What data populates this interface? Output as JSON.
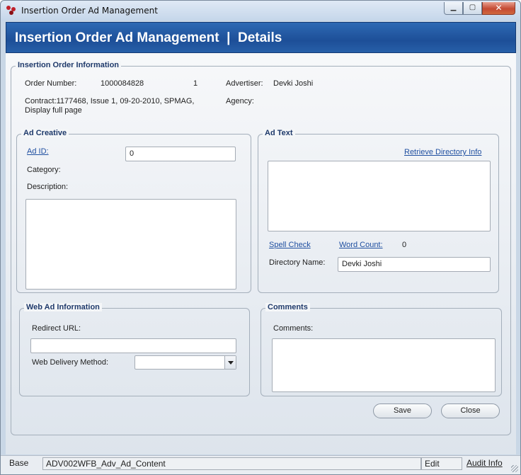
{
  "window": {
    "title": "Insertion Order Ad Management",
    "minimize_glyph": "▁",
    "maximize_glyph": "▢",
    "close_glyph": "✕"
  },
  "banner": {
    "title": "Insertion Order Ad Management  |  Details"
  },
  "io_info": {
    "legend": "Insertion Order Information",
    "order_number_label": "Order Number:",
    "order_number_value": "1000084828",
    "order_seq": "1",
    "advertiser_label": "Advertiser:",
    "advertiser_value": "Devki Joshi",
    "contract_line1": "Contract:1177468, Issue 1, 09-20-2010, SPMAG,",
    "contract_line2": "Display full page",
    "agency_label": "Agency:"
  },
  "ad_creative": {
    "legend": "Ad Creative",
    "ad_id_label": "Ad ID:",
    "ad_id_value": "0",
    "category_label": "Category:",
    "description_label": "Description:"
  },
  "ad_text": {
    "legend": "Ad Text",
    "retrieve_link": "Retrieve Directory Info",
    "spell_check_link": "Spell Check",
    "word_count_link": "Word Count:",
    "word_count_value": "0",
    "directory_name_label": "Directory Name:",
    "directory_name_value": "Devki Joshi"
  },
  "web_ad": {
    "legend": "Web Ad Information",
    "redirect_url_label": "Redirect URL:",
    "redirect_url_value": "",
    "delivery_method_label": "Web Delivery Method:",
    "delivery_method_value": ""
  },
  "comments": {
    "legend": "Comments",
    "comments_label": "Comments:"
  },
  "buttons": {
    "save": "Save",
    "close": "Close"
  },
  "statusbar": {
    "base": "Base",
    "screen_id": "ADV002WFB_Adv_Ad_Content",
    "mode": "Edit",
    "audit_link": "Audit Info"
  },
  "colors": {
    "banner": "#1d4f98",
    "link": "#1f4fa0",
    "legend": "#1f3a6b"
  }
}
